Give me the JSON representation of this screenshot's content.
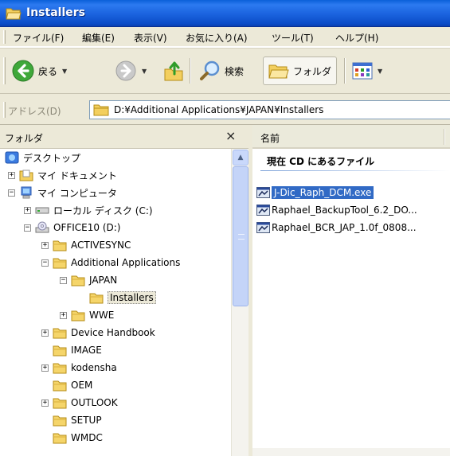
{
  "window": {
    "title": "Installers",
    "icon": "folder-open-icon"
  },
  "menu": {
    "items": [
      "ファイル(F)",
      "編集(E)",
      "表示(V)",
      "お気に入り(A)",
      "ツール(T)",
      "ヘルプ(H)"
    ]
  },
  "toolbar": {
    "back_label": "戻る",
    "search_label": "検索",
    "folders_label": "フォルダ"
  },
  "address": {
    "label": "アドレス(D)",
    "path": "D:¥Additional Applications¥JAPAN¥Installers"
  },
  "folders_pane": {
    "title": "フォルダ",
    "close_glyph": "×",
    "tree": [
      {
        "label": "デスクトップ",
        "icon": "desktop-icon",
        "expander": ""
      },
      {
        "label": "マイ ドキュメント",
        "icon": "my-documents-icon",
        "expander": "+"
      },
      {
        "label": "マイ コンピュータ",
        "icon": "my-computer-icon",
        "expander": "−"
      },
      {
        "label": "ローカル ディスク (C:)",
        "icon": "hard-drive-icon",
        "expander": "+"
      },
      {
        "label": "OFFICE10 (D:)",
        "icon": "cd-drive-icon",
        "expander": "−"
      },
      {
        "label": "ACTIVESYNC",
        "icon": "folder-icon",
        "expander": "+"
      },
      {
        "label": "Additional Applications",
        "icon": "folder-icon",
        "expander": "−"
      },
      {
        "label": "JAPAN",
        "icon": "folder-icon",
        "expander": "−"
      },
      {
        "label": "Installers",
        "icon": "folder-icon",
        "expander": "",
        "selected": true
      },
      {
        "label": "WWE",
        "icon": "folder-icon",
        "expander": "+"
      },
      {
        "label": "Device Handbook",
        "icon": "folder-icon",
        "expander": "+"
      },
      {
        "label": "IMAGE",
        "icon": "folder-icon",
        "expander": ""
      },
      {
        "label": "kodensha",
        "icon": "folder-icon",
        "expander": "+"
      },
      {
        "label": "OEM",
        "icon": "folder-icon",
        "expander": ""
      },
      {
        "label": "OUTLOOK",
        "icon": "folder-icon",
        "expander": "+"
      },
      {
        "label": "SETUP",
        "icon": "folder-icon",
        "expander": ""
      },
      {
        "label": "WMDC",
        "icon": "folder-icon",
        "expander": ""
      }
    ]
  },
  "file_list": {
    "column_name": "名前",
    "group_title": "現在 CD にあるファイル",
    "files": [
      {
        "name": "J-Dic_Raph_DCM.exe",
        "icon": "installer-exe-icon",
        "selected": true
      },
      {
        "name": "Raphael_BackupTool_6.2_DO...",
        "icon": "installer-exe-icon"
      },
      {
        "name": "Raphael_BCR_JAP_1.0f_0808...",
        "icon": "installer-exe-icon"
      }
    ]
  },
  "colors": {
    "titlebar": "#0a5fd8",
    "chrome": "#ece9d8",
    "selection": "#316ac5",
    "folder": "#f5d56a"
  }
}
